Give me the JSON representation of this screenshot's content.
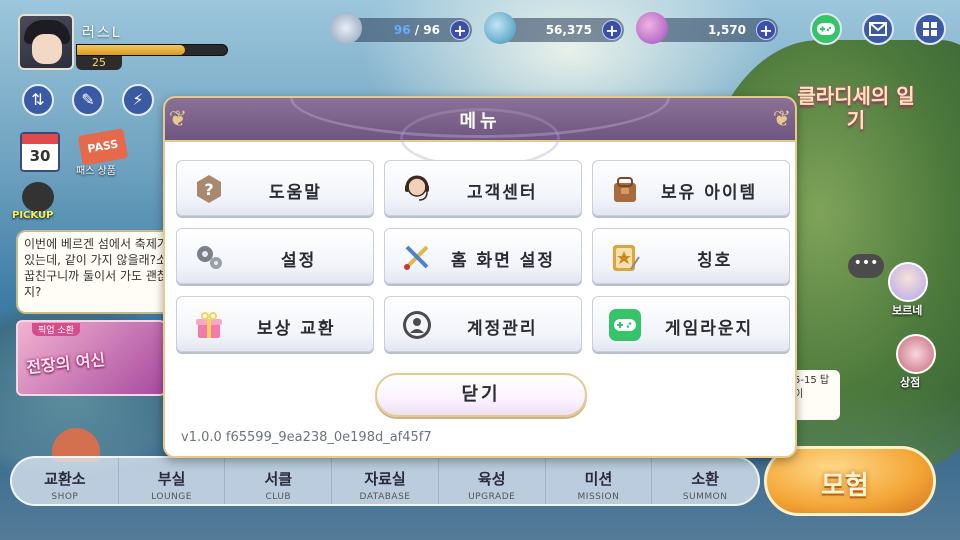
{
  "player": {
    "name": "러스L",
    "level": "25",
    "exp_fraction": 0.72
  },
  "resources": [
    {
      "name": "stamina",
      "current": "96",
      "separator": " / ",
      "max": "96"
    },
    {
      "name": "gold",
      "value": "56,375"
    },
    {
      "name": "gem",
      "value": "1,570"
    }
  ],
  "hud": {
    "plus_symbol": "+"
  },
  "left_panel": {
    "calendar_day": "30",
    "pass_badge": "PASS",
    "pass_label": "패스 상품",
    "pickup_label": "PICKUP",
    "chat_text": "이번에 베르겐 섬에서 축제가 있는데, 같이 가지 않을래?소꿉친구니까 둘이서 가도 괜찮지?",
    "event_tag": "픽업 소환",
    "event_title": "전장의 여신"
  },
  "right_panel": {
    "diary_title": "클라디세의 일기",
    "more_dots": "•••",
    "char1_label": "보르네",
    "char2_label": "상점",
    "note_text": "5-15 탑이"
  },
  "modal": {
    "title": "메뉴",
    "buttons": [
      {
        "id": "help",
        "label": "도움말",
        "icon": "help-icon"
      },
      {
        "id": "support",
        "label": "고객센터",
        "icon": "headset-icon"
      },
      {
        "id": "items",
        "label": "보유 아이템",
        "icon": "bag-icon"
      },
      {
        "id": "settings",
        "label": "설정",
        "icon": "gears-icon"
      },
      {
        "id": "home",
        "label": "홈 화면 설정",
        "icon": "brush-icon"
      },
      {
        "id": "title",
        "label": "칭호",
        "icon": "title-book-icon"
      },
      {
        "id": "reward",
        "label": "보상 교환",
        "icon": "gift-icon"
      },
      {
        "id": "account",
        "label": "계정관리",
        "icon": "user-icon"
      },
      {
        "id": "lounge",
        "label": "게임라운지",
        "icon": "gamepad-icon"
      }
    ],
    "close_label": "닫기",
    "version": "v1.0.0 f65599_9ea238_0e198d_af45f7"
  },
  "bottom_nav": [
    {
      "ko": "교환소",
      "en": "SHOP"
    },
    {
      "ko": "부실",
      "en": "LOUNGE"
    },
    {
      "ko": "서클",
      "en": "CLUB"
    },
    {
      "ko": "자료실",
      "en": "DATABASE"
    },
    {
      "ko": "육성",
      "en": "UPGRADE"
    },
    {
      "ko": "미션",
      "en": "MISSION"
    },
    {
      "ko": "소환",
      "en": "SUMMON"
    }
  ],
  "adventure_label": "모험",
  "colors": {
    "header": "#7a6490",
    "accent_gold": "#e7c98e",
    "plus_button": "#3b4fa8",
    "lounge_green": "#35c46a"
  }
}
